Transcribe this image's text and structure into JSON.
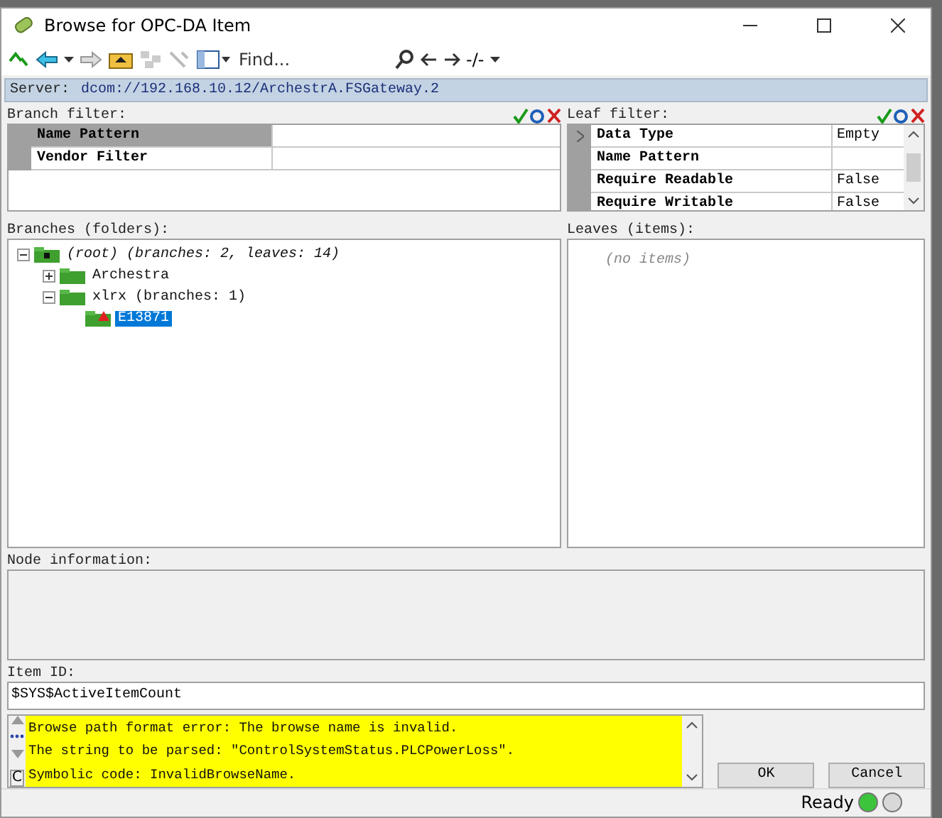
{
  "window": {
    "title": "Browse for OPC-DA Item"
  },
  "toolbar": {
    "find_placeholder": "Find...",
    "path": "-/-"
  },
  "server": {
    "label": "Server:",
    "value": "dcom://192.168.10.12/ArchestrA.FSGateway.2"
  },
  "branch_filter": {
    "title": "Branch filter:",
    "rows": [
      {
        "name": "Name Pattern",
        "value": "",
        "selected": true
      },
      {
        "name": "Vendor Filter",
        "value": "",
        "selected": false
      }
    ]
  },
  "leaf_filter": {
    "title": "Leaf filter:",
    "rows": [
      {
        "name": "Data Type",
        "value": "Empty",
        "selected": true
      },
      {
        "name": "Name Pattern",
        "value": "",
        "selected": false
      },
      {
        "name": "Require Readable",
        "value": "False",
        "selected": false
      },
      {
        "name": "Require Writable",
        "value": "False",
        "selected": false
      }
    ]
  },
  "branches": {
    "title": "Branches (folders):",
    "tree": [
      {
        "label": "(root) (branches: 2, leaves: 14)",
        "kind": "root",
        "expanded": true,
        "selected": false,
        "children": [
          {
            "label": "Archestra",
            "kind": "folder",
            "expanded": false,
            "selected": false
          },
          {
            "label": "xlrx (branches: 1)",
            "kind": "folder",
            "expanded": true,
            "selected": false,
            "children": [
              {
                "label": "E13871",
                "kind": "flagged",
                "selected": true
              }
            ]
          }
        ]
      }
    ]
  },
  "leaves": {
    "title": "Leaves (items):",
    "empty_text": "(no items)"
  },
  "node_information": {
    "title": "Node information:"
  },
  "item_id": {
    "label": "Item ID:",
    "value": "$SYS$ActiveItemCount"
  },
  "messages": [
    "Browse path format error: The browse name is invalid.",
    "The string to be parsed: \"ControlSystemStatus.PLCPowerLoss\".",
    "Symbolic code: InvalidBrowseName."
  ],
  "message_side_label": "C",
  "buttons": [
    {
      "label": "OK"
    },
    {
      "label": "Cancel"
    }
  ],
  "status": {
    "text": "Ready",
    "lights": [
      {
        "color": "#3cc43c"
      },
      {
        "color": "#d8d8d8"
      }
    ]
  }
}
